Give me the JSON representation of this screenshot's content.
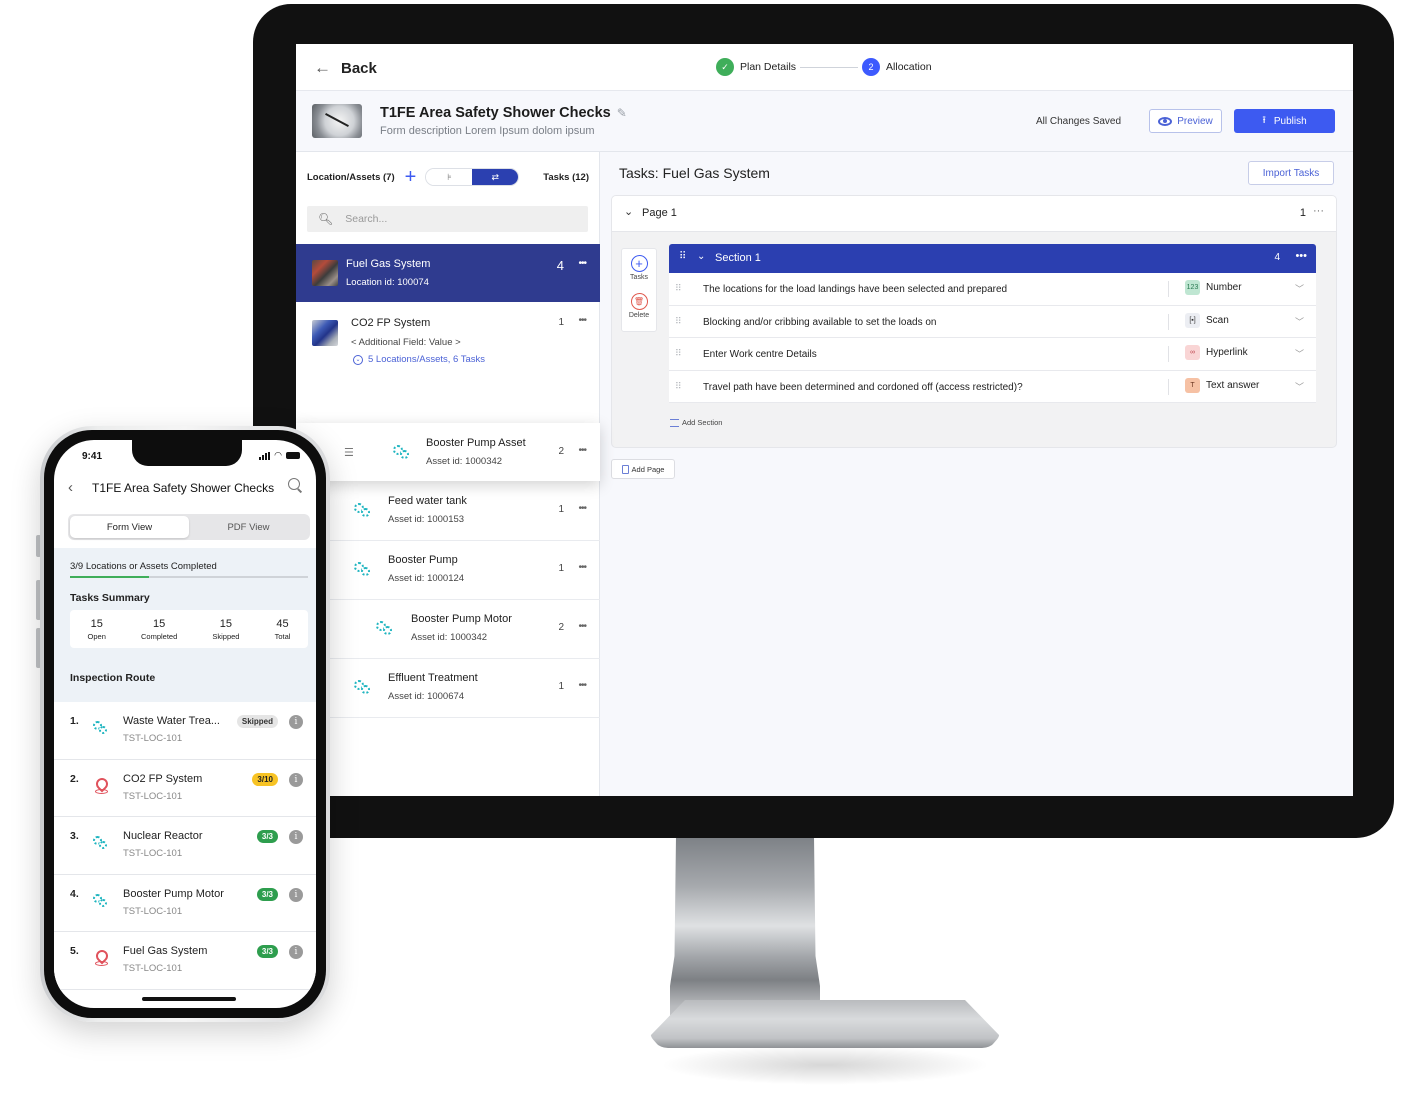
{
  "desktop": {
    "topbar": {
      "back_label": "Back",
      "steps": [
        {
          "label": "Plan Details",
          "state": "done"
        },
        {
          "label": "Allocation",
          "state": "active",
          "number": "2"
        }
      ]
    },
    "header": {
      "title": "T1FE Area Safety Shower Checks",
      "description": "Form description Lorem Ipsum dolom ipsum",
      "save_status": "All Changes Saved",
      "preview_label": "Preview",
      "publish_label": "Publish"
    },
    "left_panel": {
      "locations_label": "Location/Assets (7)",
      "tasks_label": "Tasks (12)",
      "search_placeholder": "Search...",
      "items": [
        {
          "name": "Fuel Gas System",
          "sub": "Location id: 100074",
          "count": "4",
          "type": "location",
          "selected": true
        },
        {
          "name": "CO2 FP System",
          "sub": "< Additional Field: Value >",
          "link": "5 Locations/Assets, 6 Tasks",
          "count": "1",
          "type": "location"
        },
        {
          "name": "Booster Pump Asset",
          "sub": "Asset id: 1000342",
          "count": "2",
          "type": "asset",
          "dragging": true
        },
        {
          "name": "Feed water tank",
          "sub": "Asset id: 1000153",
          "count": "1",
          "type": "asset"
        },
        {
          "name": "Booster Pump",
          "sub": "Asset id: 1000124",
          "count": "1",
          "type": "asset"
        },
        {
          "name": "Booster Pump Motor",
          "sub": "Asset id: 1000342",
          "count": "2",
          "type": "asset"
        },
        {
          "name": "Effluent Treatment",
          "sub": "Asset id: 1000674",
          "count": "1",
          "type": "asset"
        }
      ]
    },
    "right_panel": {
      "title": "Tasks: Fuel Gas System",
      "import_label": "Import Tasks",
      "page": {
        "label": "Page 1",
        "count": "1"
      },
      "tools": {
        "add_label": "Tasks",
        "delete_label": "Delete"
      },
      "section": {
        "label": "Section 1",
        "count": "4",
        "tasks": [
          {
            "text": "The locations for the load landings have been selected and prepared",
            "response": "Number",
            "badge_text": "123",
            "badge_bg": "#bfe6d2",
            "badge_fg": "#2a7a52"
          },
          {
            "text": "Blocking and/or cribbing available to set the loads on",
            "response": "Scan",
            "badge_text": "[▪]",
            "badge_bg": "#eceef3",
            "badge_fg": "#333333"
          },
          {
            "text": "Enter Work centre Details",
            "response": "Hyperlink",
            "badge_text": "∞",
            "badge_bg": "#f9d5d5",
            "badge_fg": "#c0474f"
          },
          {
            "text": "Travel path have been determined and cordoned off (access restricted)?",
            "response": "Text answer",
            "badge_text": "T",
            "badge_bg": "#f6c1a4",
            "badge_fg": "#6a3520"
          }
        ]
      },
      "add_section_label": "Add Section",
      "add_page_label": "Add Page"
    }
  },
  "mobile": {
    "status_time": "9:41",
    "title": "T1FE Area Safety Shower Checks",
    "tabs": [
      {
        "label": "Form View",
        "active": true
      },
      {
        "label": "PDF View",
        "active": false
      }
    ],
    "progress": {
      "label": "3/9 Locations or Assets Completed",
      "completed": 3,
      "total": 9
    },
    "tasks_summary": {
      "title": "Tasks Summary",
      "stats": [
        {
          "value": "15",
          "label": "Open"
        },
        {
          "value": "15",
          "label": "Completed"
        },
        {
          "value": "15",
          "label": "Skipped"
        },
        {
          "value": "45",
          "label": "Total"
        }
      ]
    },
    "inspection_route": {
      "title": "Inspection Route",
      "items": [
        {
          "index": "1.",
          "name": "Waste Water Trea...",
          "code": "TST-LOC-101",
          "badge": "Skipped",
          "status": "skipped",
          "type": "asset"
        },
        {
          "index": "2.",
          "name": "CO2 FP System",
          "code": "TST-LOC-101",
          "badge": "3/10",
          "status": "partial",
          "type": "location"
        },
        {
          "index": "3.",
          "name": "Nuclear Reactor",
          "code": "TST-LOC-101",
          "badge": "3/3",
          "status": "done",
          "type": "asset"
        },
        {
          "index": "4.",
          "name": "Booster Pump Motor",
          "code": "TST-LOC-101",
          "badge": "3/3",
          "status": "done",
          "type": "asset"
        },
        {
          "index": "5.",
          "name": "Fuel Gas System",
          "code": "TST-LOC-101",
          "badge": "3/3",
          "status": "done",
          "type": "location"
        }
      ]
    }
  },
  "colors": {
    "primary": "#3d5af1",
    "selected_nav": "#2f3b8f",
    "section_header": "#2b3fb0",
    "success": "#3fae5a",
    "asset_icon": "#1fb5c0",
    "location_icon": "#e0525c",
    "warning": "#f7c325"
  }
}
